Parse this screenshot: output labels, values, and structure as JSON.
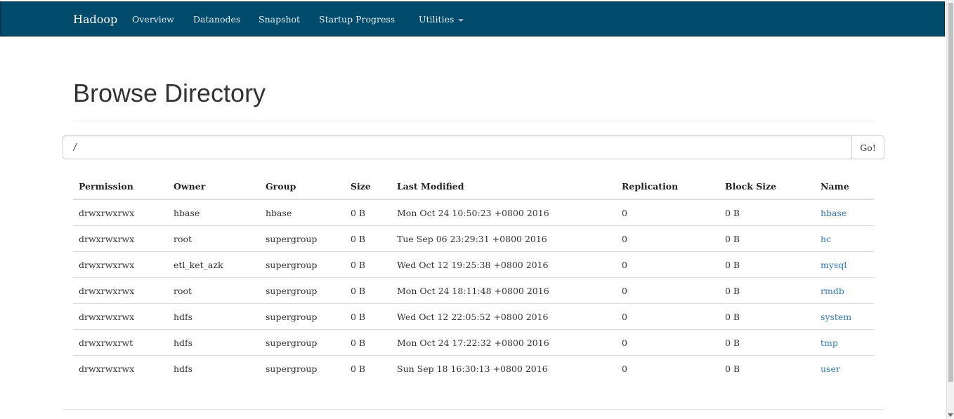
{
  "navbar": {
    "brand": "Hadoop",
    "items": [
      {
        "label": "Overview"
      },
      {
        "label": "Datanodes"
      },
      {
        "label": "Snapshot"
      },
      {
        "label": "Startup Progress"
      },
      {
        "label": "Utilities",
        "has_dropdown": true
      }
    ],
    "background_color": "#004b6b"
  },
  "page": {
    "title": "Browse Directory"
  },
  "path_bar": {
    "value": "/",
    "go_label": "Go!"
  },
  "table": {
    "headers": [
      "Permission",
      "Owner",
      "Group",
      "Size",
      "Last Modified",
      "Replication",
      "Block Size",
      "Name"
    ],
    "rows": [
      {
        "permission": "drwxrwxrwx",
        "owner": "hbase",
        "group": "hbase",
        "size": "0 B",
        "last_modified": "Mon Oct 24 10:50:23 +0800 2016",
        "replication": "0",
        "block_size": "0 B",
        "name": "hbase"
      },
      {
        "permission": "drwxrwxrwx",
        "owner": "root",
        "group": "supergroup",
        "size": "0 B",
        "last_modified": "Tue Sep 06 23:29:31 +0800 2016",
        "replication": "0",
        "block_size": "0 B",
        "name": "hc"
      },
      {
        "permission": "drwxrwxrwx",
        "owner": "etl_ket_azk",
        "group": "supergroup",
        "size": "0 B",
        "last_modified": "Wed Oct 12 19:25:38 +0800 2016",
        "replication": "0",
        "block_size": "0 B",
        "name": "mysql"
      },
      {
        "permission": "drwxrwxrwx",
        "owner": "root",
        "group": "supergroup",
        "size": "0 B",
        "last_modified": "Mon Oct 24 18:11:48 +0800 2016",
        "replication": "0",
        "block_size": "0 B",
        "name": "rmdb"
      },
      {
        "permission": "drwxrwxrwx",
        "owner": "hdfs",
        "group": "supergroup",
        "size": "0 B",
        "last_modified": "Wed Oct 12 22:05:52 +0800 2016",
        "replication": "0",
        "block_size": "0 B",
        "name": "system"
      },
      {
        "permission": "drwxrwxrwt",
        "owner": "hdfs",
        "group": "supergroup",
        "size": "0 B",
        "last_modified": "Mon Oct 24 17:22:32 +0800 2016",
        "replication": "0",
        "block_size": "0 B",
        "name": "tmp"
      },
      {
        "permission": "drwxrwxrwx",
        "owner": "hdfs",
        "group": "supergroup",
        "size": "0 B",
        "last_modified": "Sun Sep 18 16:30:13 +0800 2016",
        "replication": "0",
        "block_size": "0 B",
        "name": "user"
      }
    ],
    "link_color": "#337ab7"
  }
}
